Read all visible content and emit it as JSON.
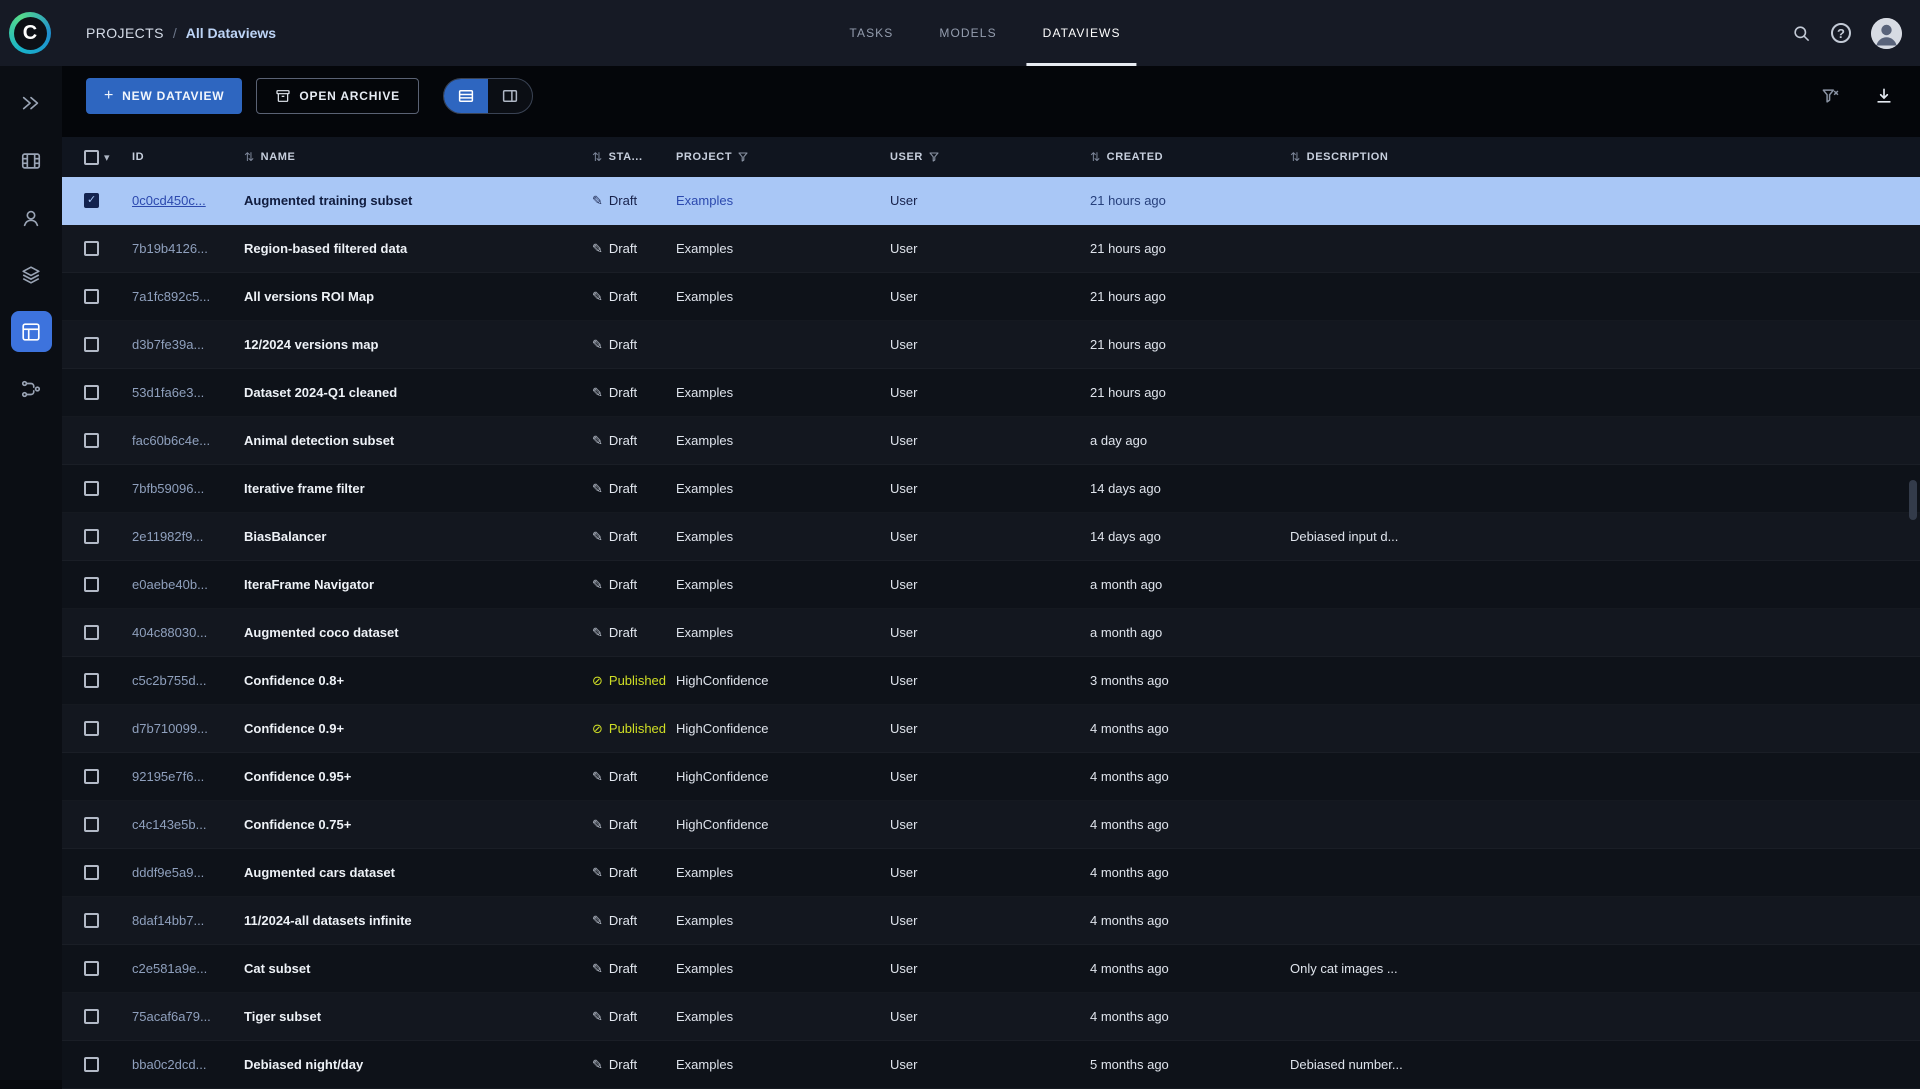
{
  "brand": {
    "logo_letter": "C"
  },
  "breadcrumb": {
    "root": "PROJECTS",
    "separator": "/",
    "current": "All Dataviews"
  },
  "nav_tabs": [
    {
      "label": "TASKS"
    },
    {
      "label": "MODELS"
    },
    {
      "label": "DATAVIEWS"
    }
  ],
  "active_tab": "DATAVIEWS",
  "toolbar": {
    "new_dataview_label": "NEW DATAVIEW",
    "open_archive_label": "OPEN ARCHIVE"
  },
  "icons": {
    "plus": "+",
    "caret_down": "▾",
    "sort": "⇅",
    "help": "?",
    "draft": "✎",
    "published": "⊘"
  },
  "sidebar_items": [
    {
      "name": "projects"
    },
    {
      "name": "datasets"
    },
    {
      "name": "workers"
    },
    {
      "name": "hyper-datasets"
    },
    {
      "name": "dataviews",
      "active": true
    },
    {
      "name": "pipelines"
    }
  ],
  "colors": {
    "accent_blue": "#2e66c0",
    "selected_row": "#a9c7f6",
    "published_status": "#d0df25"
  },
  "table": {
    "headers": {
      "id": "ID",
      "name": "NAME",
      "status": "STA...",
      "project": "PROJECT",
      "user": "USER",
      "created": "CREATED",
      "description": "DESCRIPTION"
    },
    "rows": [
      {
        "id": "0c0cd450c...",
        "name": "Augmented training subset",
        "status": "Draft",
        "published": false,
        "project": "Examples",
        "user": "User",
        "created": "21 hours ago",
        "description": "",
        "selected": true
      },
      {
        "id": "7b19b4126...",
        "name": "Region-based filtered data",
        "status": "Draft",
        "published": false,
        "project": "Examples",
        "user": "User",
        "created": "21 hours ago",
        "description": "",
        "selected": false
      },
      {
        "id": "7a1fc892c5...",
        "name": "All versions ROI Map",
        "status": "Draft",
        "published": false,
        "project": "Examples",
        "user": "User",
        "created": "21 hours ago",
        "description": "",
        "selected": false
      },
      {
        "id": "d3b7fe39a...",
        "name": "12/2024 versions map",
        "status": "Draft",
        "published": false,
        "project": "",
        "user": "User",
        "created": "21 hours ago",
        "description": "",
        "selected": false
      },
      {
        "id": "53d1fa6e3...",
        "name": "Dataset 2024-Q1 cleaned",
        "status": "Draft",
        "published": false,
        "project": "Examples",
        "user": "User",
        "created": "21 hours ago",
        "description": "",
        "selected": false
      },
      {
        "id": "fac60b6c4e...",
        "name": "Animal detection subset",
        "status": "Draft",
        "published": false,
        "project": "Examples",
        "user": "User",
        "created": "a day ago",
        "description": "",
        "selected": false
      },
      {
        "id": "7bfb59096...",
        "name": "Iterative frame filter",
        "status": "Draft",
        "published": false,
        "project": "Examples",
        "user": "User",
        "created": "14 days ago",
        "description": "",
        "selected": false
      },
      {
        "id": "2e11982f9...",
        "name": "BiasBalancer",
        "status": "Draft",
        "published": false,
        "project": "Examples",
        "user": "User",
        "created": "14 days ago",
        "description": "Debiased input d...",
        "selected": false
      },
      {
        "id": "e0aebe40b...",
        "name": "IteraFrame Navigator",
        "status": "Draft",
        "published": false,
        "project": "Examples",
        "user": "User",
        "created": "a month ago",
        "description": "",
        "selected": false
      },
      {
        "id": "404c88030...",
        "name": "Augmented coco dataset",
        "status": "Draft",
        "published": false,
        "project": "Examples",
        "user": "User",
        "created": "a month ago",
        "description": "",
        "selected": false
      },
      {
        "id": "c5c2b755d...",
        "name": "Confidence 0.8+",
        "status": "Published",
        "published": true,
        "project": "HighConfidence",
        "user": "User",
        "created": "3 months ago",
        "description": "",
        "selected": false
      },
      {
        "id": "d7b710099...",
        "name": "Confidence 0.9+",
        "status": "Published",
        "published": true,
        "project": "HighConfidence",
        "user": "User",
        "created": "4 months ago",
        "description": "",
        "selected": false
      },
      {
        "id": "92195e7f6...",
        "name": "Confidence 0.95+",
        "status": "Draft",
        "published": false,
        "project": "HighConfidence",
        "user": "User",
        "created": "4 months ago",
        "description": "",
        "selected": false
      },
      {
        "id": "c4c143e5b...",
        "name": "Confidence 0.75+",
        "status": "Draft",
        "published": false,
        "project": "HighConfidence",
        "user": "User",
        "created": "4 months ago",
        "description": "",
        "selected": false
      },
      {
        "id": "dddf9e5a9...",
        "name": "Augmented cars dataset",
        "status": "Draft",
        "published": false,
        "project": "Examples",
        "user": "User",
        "created": "4 months ago",
        "description": "",
        "selected": false
      },
      {
        "id": "8daf14bb7...",
        "name": "11/2024-all datasets infinite",
        "status": "Draft",
        "published": false,
        "project": "Examples",
        "user": "User",
        "created": "4 months ago",
        "description": "",
        "selected": false
      },
      {
        "id": "c2e581a9e...",
        "name": "Cat subset",
        "status": "Draft",
        "published": false,
        "project": "Examples",
        "user": "User",
        "created": "4 months ago",
        "description": "Only cat images ...",
        "selected": false
      },
      {
        "id": "75acaf6a79...",
        "name": "Tiger subset",
        "status": "Draft",
        "published": false,
        "project": "Examples",
        "user": "User",
        "created": "4 months ago",
        "description": "",
        "selected": false
      },
      {
        "id": "bba0c2dcd...",
        "name": "Debiased night/day",
        "status": "Draft",
        "published": false,
        "project": "Examples",
        "user": "User",
        "created": "5 months ago",
        "description": "Debiased number...",
        "selected": false
      }
    ]
  }
}
